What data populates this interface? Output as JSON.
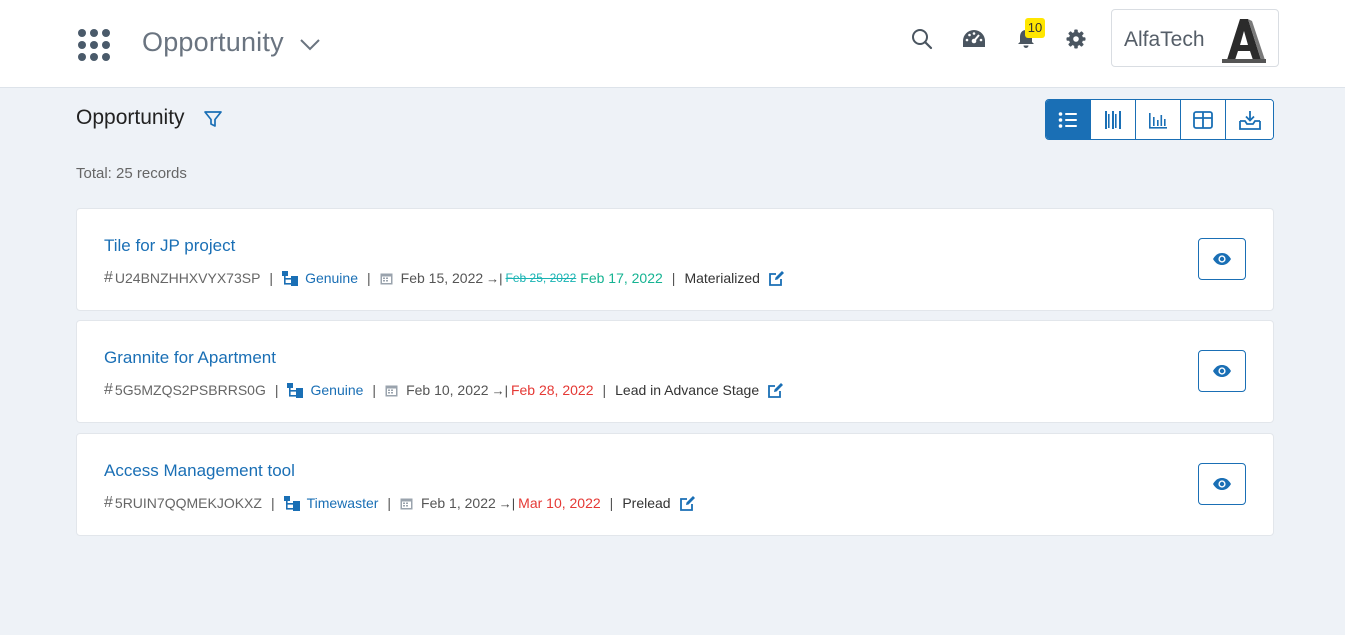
{
  "header": {
    "app_title": "Opportunity",
    "notification_count": "10",
    "account_name": "AlfaTech"
  },
  "page": {
    "title": "Opportunity",
    "total": "Total: 25 records"
  },
  "records": [
    {
      "title": "Tile for JP project",
      "code": "U24BNZHHXVYX73SP",
      "tag": "Genuine",
      "start_date": "Feb 15, 2022",
      "old_end_date": "Feb 25, 2022",
      "end_date": "Feb 17, 2022",
      "end_color": "#15b392",
      "status": "Materialized"
    },
    {
      "title": "Grannite for Apartment",
      "code": "5G5MZQS2PSBRRS0G",
      "tag": "Genuine",
      "start_date": "Feb 10, 2022",
      "end_date": "Feb 28, 2022",
      "end_color": "#e53935",
      "status": "Lead in Advance Stage"
    },
    {
      "title": "Access Management tool",
      "code": "5RUIN7QQMEKJOKXZ",
      "tag": "Timewaster",
      "start_date": "Feb 1, 2022",
      "end_date": "Mar 10, 2022",
      "end_color": "#e53935",
      "status": "Prelead"
    }
  ],
  "icons": {
    "apps": "grid-dots-icon",
    "search": "search-icon",
    "dashboard": "speedometer-icon",
    "notifications": "bell-icon",
    "settings": "gear-icon",
    "filter": "filter-icon",
    "views": [
      "list-icon",
      "kanban-icon",
      "chart-icon",
      "table-icon",
      "download-icon"
    ],
    "tag": "hierarchy-icon",
    "date": "calendar-icon",
    "edit": "edit-icon",
    "view": "eye-icon"
  },
  "colors": {
    "accent": "#1a6fb5",
    "badge": "#ffe600",
    "background": "#eef2f7"
  }
}
